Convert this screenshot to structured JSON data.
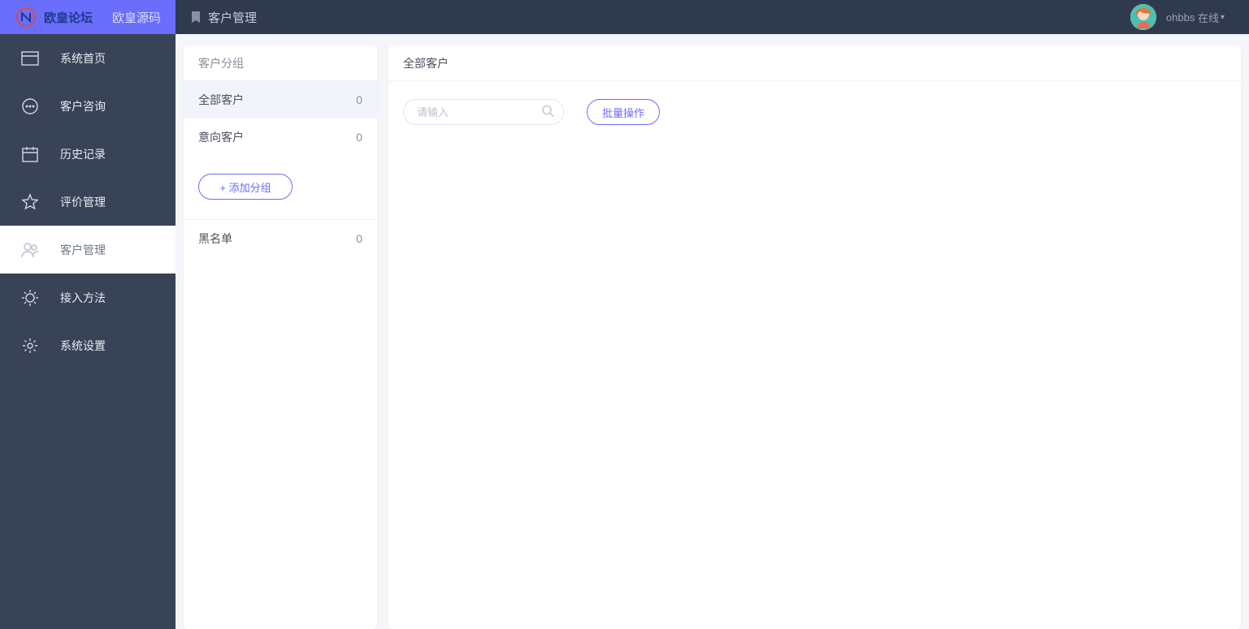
{
  "brand": {
    "logo_text": "N",
    "name_blue": "欧皇论坛",
    "name_light": "欧皇源码"
  },
  "header": {
    "title": "客户管理"
  },
  "user": {
    "name": "ohbbs",
    "status": "在线"
  },
  "sidebar": {
    "items": [
      {
        "label": "系统首页",
        "icon": "window-icon"
      },
      {
        "label": "客户咨询",
        "icon": "chat-icon"
      },
      {
        "label": "历史记录",
        "icon": "calendar-icon"
      },
      {
        "label": "评价管理",
        "icon": "star-icon"
      },
      {
        "label": "客户管理",
        "icon": "user-icon"
      },
      {
        "label": "接入方法",
        "icon": "plug-icon"
      },
      {
        "label": "系统设置",
        "icon": "gear-icon"
      }
    ],
    "active_index": 4
  },
  "groups_panel": {
    "title": "客户分组",
    "items": [
      {
        "label": "全部客户",
        "count": 0
      },
      {
        "label": "意向客户",
        "count": 0
      }
    ],
    "add_label": "+ 添加分组",
    "blacklist": {
      "label": "黑名单",
      "count": 0
    },
    "selected_index": 0
  },
  "content": {
    "title": "全部客户",
    "search_placeholder": "请输入",
    "batch_label": "批量操作"
  }
}
